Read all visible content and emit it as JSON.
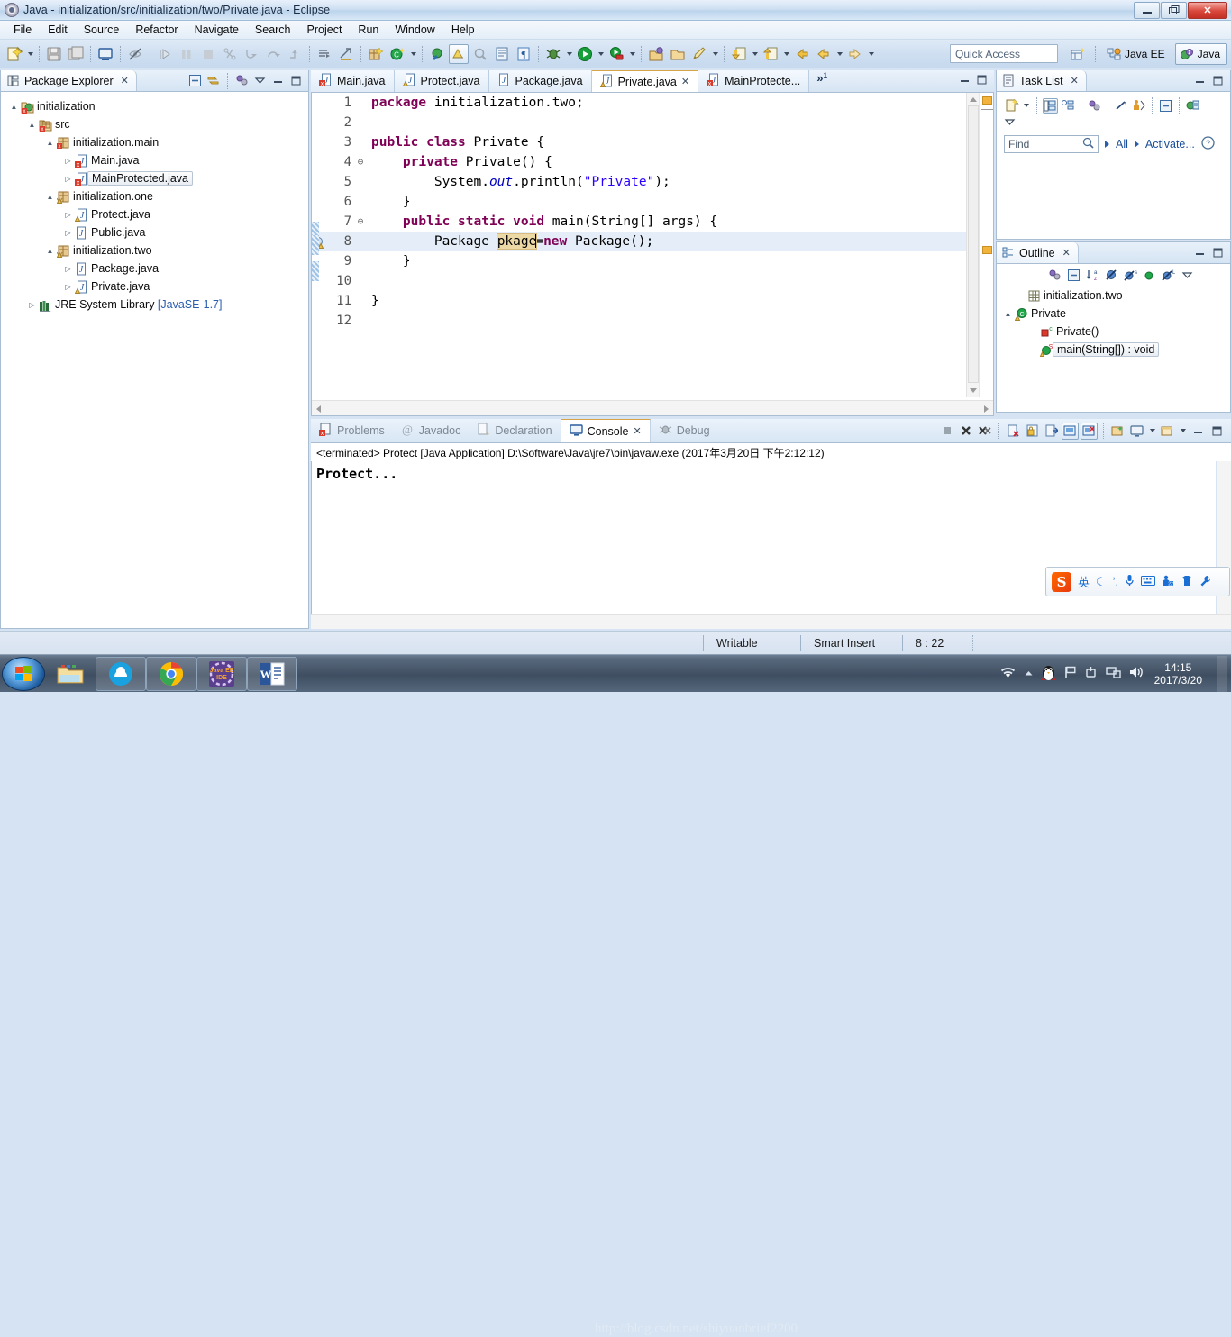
{
  "window": {
    "title": "Java - initialization/src/initialization/two/Private.java - Eclipse",
    "minimize": "—",
    "maximize": "❐",
    "close": "✕"
  },
  "menubar": {
    "items": [
      "File",
      "Edit",
      "Source",
      "Refactor",
      "Navigate",
      "Search",
      "Project",
      "Run",
      "Window",
      "Help"
    ]
  },
  "toolbar": {
    "quick_access_placeholder": "Quick Access",
    "perspectives": [
      {
        "label": "Java EE",
        "active": false
      },
      {
        "label": "Java",
        "active": true
      }
    ]
  },
  "package_explorer": {
    "tab_label": "Package Explorer",
    "close_glyph": "✕",
    "tree": [
      {
        "indent": 0,
        "expander": "▲",
        "icon": "java-project-icon",
        "label": "initialization",
        "sub": "",
        "selected": false
      },
      {
        "indent": 1,
        "expander": "▲",
        "icon": "source-folder-icon",
        "label": "src",
        "sub": "",
        "selected": false
      },
      {
        "indent": 2,
        "expander": "▲",
        "icon": "package-icon",
        "label": "initialization.main",
        "sub": "",
        "selected": false
      },
      {
        "indent": 3,
        "expander": "▷",
        "icon": "java-file-error-icon",
        "label": "Main.java",
        "sub": "",
        "selected": false
      },
      {
        "indent": 3,
        "expander": "▷",
        "icon": "java-file-error-icon",
        "label": "MainProtected.java",
        "sub": "",
        "selected": true
      },
      {
        "indent": 2,
        "expander": "▲",
        "icon": "package-warning-icon",
        "label": "initialization.one",
        "sub": "",
        "selected": false
      },
      {
        "indent": 3,
        "expander": "▷",
        "icon": "java-file-warning-icon",
        "label": "Protect.java",
        "sub": "",
        "selected": false
      },
      {
        "indent": 3,
        "expander": "▷",
        "icon": "java-file-icon",
        "label": "Public.java",
        "sub": "",
        "selected": false
      },
      {
        "indent": 2,
        "expander": "▲",
        "icon": "package-warning-icon",
        "label": "initialization.two",
        "sub": "",
        "selected": false
      },
      {
        "indent": 3,
        "expander": "▷",
        "icon": "java-file-icon",
        "label": "Package.java",
        "sub": "",
        "selected": false
      },
      {
        "indent": 3,
        "expander": "▷",
        "icon": "java-file-warning-icon",
        "label": "Private.java",
        "sub": "",
        "selected": false
      },
      {
        "indent": 1,
        "expander": "▷",
        "icon": "jre-library-icon",
        "label": "JRE System Library ",
        "sub": "[JavaSE-1.7]",
        "selected": false
      }
    ]
  },
  "editor": {
    "tabs": [
      {
        "label": "Main.java",
        "icon": "java-file-error-icon",
        "active": false,
        "closable": false
      },
      {
        "label": "Protect.java",
        "icon": "java-file-warning-icon",
        "active": false,
        "closable": false
      },
      {
        "label": "Package.java",
        "icon": "java-file-icon",
        "active": false,
        "closable": false
      },
      {
        "label": "Private.java",
        "icon": "java-file-warning-icon",
        "active": true,
        "closable": true
      },
      {
        "label": "MainProtecte...",
        "icon": "java-file-error-icon",
        "active": false,
        "closable": false
      }
    ],
    "overflow_label": "»",
    "overflow_count": "1",
    "close_glyph": "✕",
    "lines": [
      {
        "num": "1",
        "fold": "",
        "highlight": false,
        "marker": "",
        "ruler": false,
        "tokens": [
          {
            "t": "package ",
            "c": "kw"
          },
          {
            "t": "initialization.two;",
            "c": ""
          }
        ]
      },
      {
        "num": "2",
        "fold": "",
        "highlight": false,
        "marker": "",
        "ruler": false,
        "tokens": []
      },
      {
        "num": "3",
        "fold": "",
        "highlight": false,
        "marker": "",
        "ruler": false,
        "tokens": [
          {
            "t": "public class ",
            "c": "kw"
          },
          {
            "t": "Private {",
            "c": ""
          }
        ]
      },
      {
        "num": "4",
        "fold": "⊖",
        "highlight": false,
        "marker": "",
        "ruler": false,
        "tokens": [
          {
            "t": "    ",
            "c": ""
          },
          {
            "t": "private ",
            "c": "kw"
          },
          {
            "t": "Private() {",
            "c": ""
          }
        ]
      },
      {
        "num": "5",
        "fold": "",
        "highlight": false,
        "marker": "",
        "ruler": false,
        "tokens": [
          {
            "t": "        System.",
            "c": ""
          },
          {
            "t": "out",
            "c": "fld"
          },
          {
            "t": ".println(",
            "c": ""
          },
          {
            "t": "\"Private\"",
            "c": "str"
          },
          {
            "t": ");",
            "c": ""
          }
        ]
      },
      {
        "num": "6",
        "fold": "",
        "highlight": false,
        "marker": "",
        "ruler": false,
        "tokens": [
          {
            "t": "    }",
            "c": ""
          }
        ]
      },
      {
        "num": "7",
        "fold": "⊖",
        "highlight": false,
        "marker": "",
        "ruler": true,
        "tokens": [
          {
            "t": "    ",
            "c": ""
          },
          {
            "t": "public static void ",
            "c": "kw"
          },
          {
            "t": "main(String[] args) {",
            "c": ""
          }
        ]
      },
      {
        "num": "8",
        "fold": "",
        "highlight": true,
        "marker": "warning-marker-icon",
        "ruler": true,
        "tokens": [
          {
            "t": "        Package ",
            "c": ""
          },
          {
            "t": "pkage",
            "c": "occ"
          },
          {
            "t": "|",
            "c": "caret"
          },
          {
            "t": "=",
            "c": ""
          },
          {
            "t": "new ",
            "c": "kw"
          },
          {
            "t": "Package();",
            "c": ""
          }
        ]
      },
      {
        "num": "9",
        "fold": "",
        "highlight": false,
        "marker": "",
        "ruler": true,
        "tokens": [
          {
            "t": "    }",
            "c": ""
          }
        ]
      },
      {
        "num": "10",
        "fold": "",
        "highlight": false,
        "marker": "",
        "ruler": false,
        "tokens": []
      },
      {
        "num": "11",
        "fold": "",
        "highlight": false,
        "marker": "",
        "ruler": false,
        "tokens": [
          {
            "t": "}",
            "c": ""
          }
        ]
      },
      {
        "num": "12",
        "fold": "",
        "highlight": false,
        "marker": "",
        "ruler": false,
        "tokens": []
      }
    ]
  },
  "console": {
    "tabs": [
      {
        "label": "Problems",
        "icon": "problems-icon",
        "active": false,
        "closable": false
      },
      {
        "label": "Javadoc",
        "icon": "javadoc-icon",
        "active": false,
        "closable": false
      },
      {
        "label": "Declaration",
        "icon": "declaration-icon",
        "active": false,
        "closable": false
      },
      {
        "label": "Console",
        "icon": "console-icon",
        "active": true,
        "closable": true
      },
      {
        "label": "Debug",
        "icon": "debug-icon",
        "active": false,
        "closable": false
      }
    ],
    "close_glyph": "✕",
    "process_line": "<terminated> Protect [Java Application] D:\\Software\\Java\\jre7\\bin\\javaw.exe (2017年3月20日 下午2:12:12)",
    "output": "Protect..."
  },
  "task_list": {
    "tab_label": "Task List",
    "close_glyph": "✕",
    "find_placeholder": "Find",
    "all_label": "All",
    "activate_label": "Activate..."
  },
  "outline": {
    "tab_label": "Outline",
    "close_glyph": "✕",
    "items": [
      {
        "indent": 1,
        "expander": "",
        "icon": "package-decl-icon",
        "label": "initialization.two",
        "selected": false
      },
      {
        "indent": 0,
        "expander": "▲",
        "icon": "class-warning-icon",
        "label": "Private",
        "selected": false
      },
      {
        "indent": 2,
        "expander": "",
        "icon": "private-constructor-icon",
        "label": "Private()",
        "selected": false
      },
      {
        "indent": 2,
        "expander": "",
        "icon": "public-static-method-icon",
        "label": "main(String[]) : void",
        "selected": true
      }
    ]
  },
  "statusbar": {
    "writable": "Writable",
    "insert_mode": "Smart Insert",
    "position": "8 : 22"
  },
  "taskbar": {
    "items": [
      {
        "name": "file-explorer",
        "framed": false
      },
      {
        "name": "browser-360",
        "framed": true
      },
      {
        "name": "google-chrome",
        "framed": true
      },
      {
        "name": "eclipse-java-ee-ide",
        "framed": true
      },
      {
        "name": "microsoft-word",
        "framed": true
      }
    ],
    "clock_time": "14:15",
    "clock_date": "2017/3/20"
  },
  "ime": {
    "brand": "S",
    "mode_label": "英",
    "icons": [
      "moon-icon",
      "comma-icon",
      "microphone-icon",
      "keyboard-icon",
      "toolbox-icon",
      "skin-icon",
      "wrench-icon"
    ]
  },
  "colors": {
    "keyword": "#7F0055",
    "string": "#2A00FF",
    "field": "#0000C0",
    "occurrence_highlight": "#ECD9A6",
    "line_highlight": "#E4EDF8",
    "link": "#1A4F99"
  }
}
